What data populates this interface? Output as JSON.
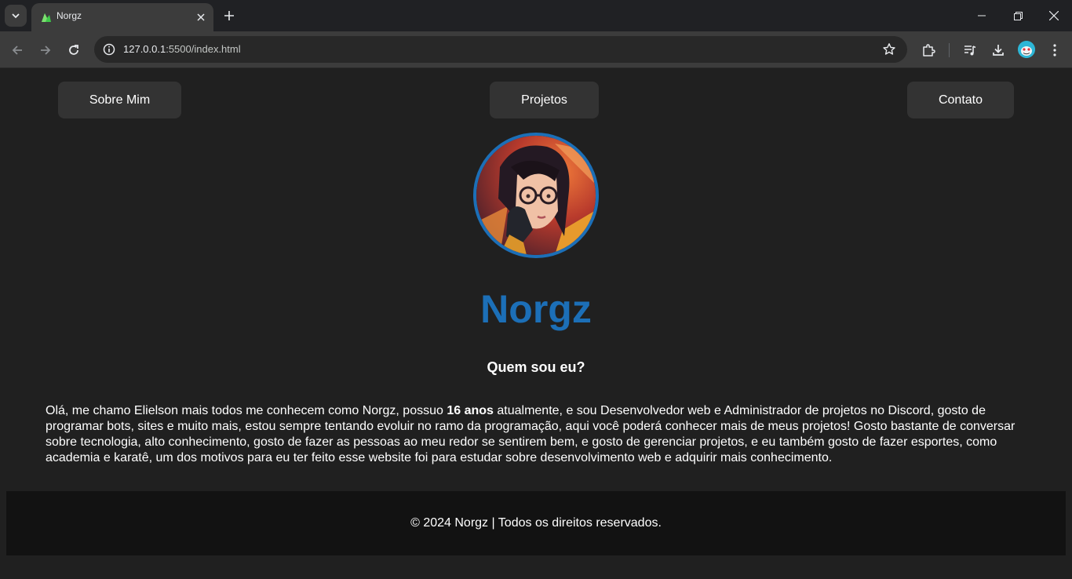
{
  "browser": {
    "tab_title": "Norgz",
    "url_host": "127.0.0.1",
    "url_path": ":5500/index.html"
  },
  "nav": {
    "about": "Sobre Mim",
    "projects": "Projetos",
    "contact": "Contato"
  },
  "hero": {
    "name": "Norgz",
    "subtitle": "Quem sou eu?"
  },
  "bio": {
    "before": "Olá, me chamo Elielson mais todos me conhecem como Norgz, possuo ",
    "highlight": "16 anos",
    "after": " atualmente, e sou Desenvolvedor web e Administrador de projetos no Discord, gosto de programar bots, sites e muito mais, estou sempre tentando evoluir no ramo da programação, aqui você poderá conhecer mais de meus projetos! Gosto bastante de conversar sobre tecnologia, alto conhecimento, gosto de fazer as pessoas ao meu redor se sentirem bem, e gosto de gerenciar projetos, e eu também gosto de fazer esportes, como academia e karatê, um dos motivos para eu ter feito esse website foi para estudar sobre desenvolvimento web e adquirir mais conhecimento."
  },
  "footer": {
    "text": "© 2024 Norgz | Todos os direitos reservados."
  },
  "colors": {
    "accent": "#1c6fb7",
    "background": "#202020",
    "button": "#333333",
    "footer": "#121212"
  }
}
